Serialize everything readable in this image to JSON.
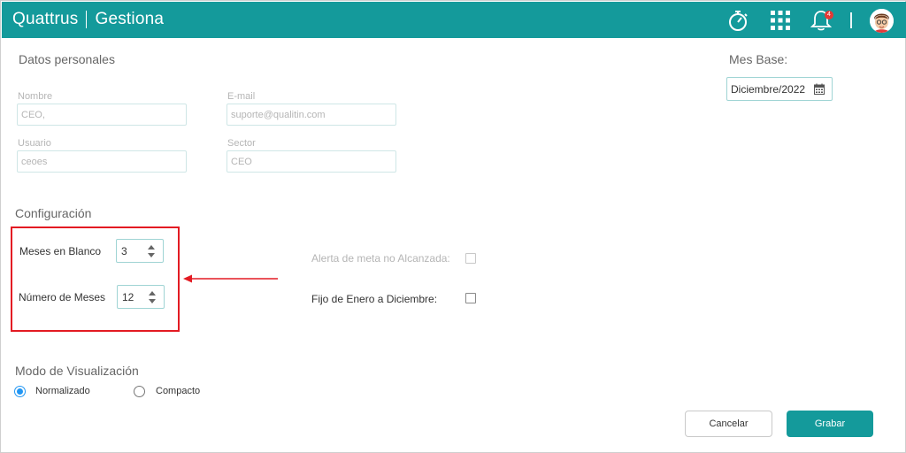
{
  "header": {
    "brand_left": "Quattrus",
    "brand_right": "Gestiona",
    "notification_count": "4",
    "icons": [
      "stopwatch-icon",
      "apps-grid-icon",
      "bell-icon",
      "user-avatar"
    ],
    "color": "#149a9b"
  },
  "personal": {
    "title": "Datos personales",
    "nombre_label": "Nombre",
    "nombre_value": "CEO,",
    "email_label": "E-mail",
    "email_value": "suporte@qualitin.com",
    "usuario_label": "Usuario",
    "usuario_value": "ceoes",
    "sector_label": "Sector",
    "sector_value": "CEO"
  },
  "mes_base": {
    "title": "Mes Base:",
    "value": "Diciembre/2022"
  },
  "config": {
    "title": "Configuración",
    "meses_blanco_label": "Meses en Blanco",
    "meses_blanco_value": "3",
    "numero_meses_label": "Número de Meses",
    "numero_meses_value": "12",
    "alerta_label": "Alerta de meta no Alcanzada:",
    "fijo_label": "Fijo de Enero a Diciembre:",
    "highlight_color": "#e31b23"
  },
  "modo": {
    "title": "Modo de Visualización",
    "options": [
      {
        "label": "Normalizado",
        "selected": true
      },
      {
        "label": "Compacto",
        "selected": false
      }
    ]
  },
  "actions": {
    "cancel_label": "Cancelar",
    "save_label": "Grabar"
  }
}
